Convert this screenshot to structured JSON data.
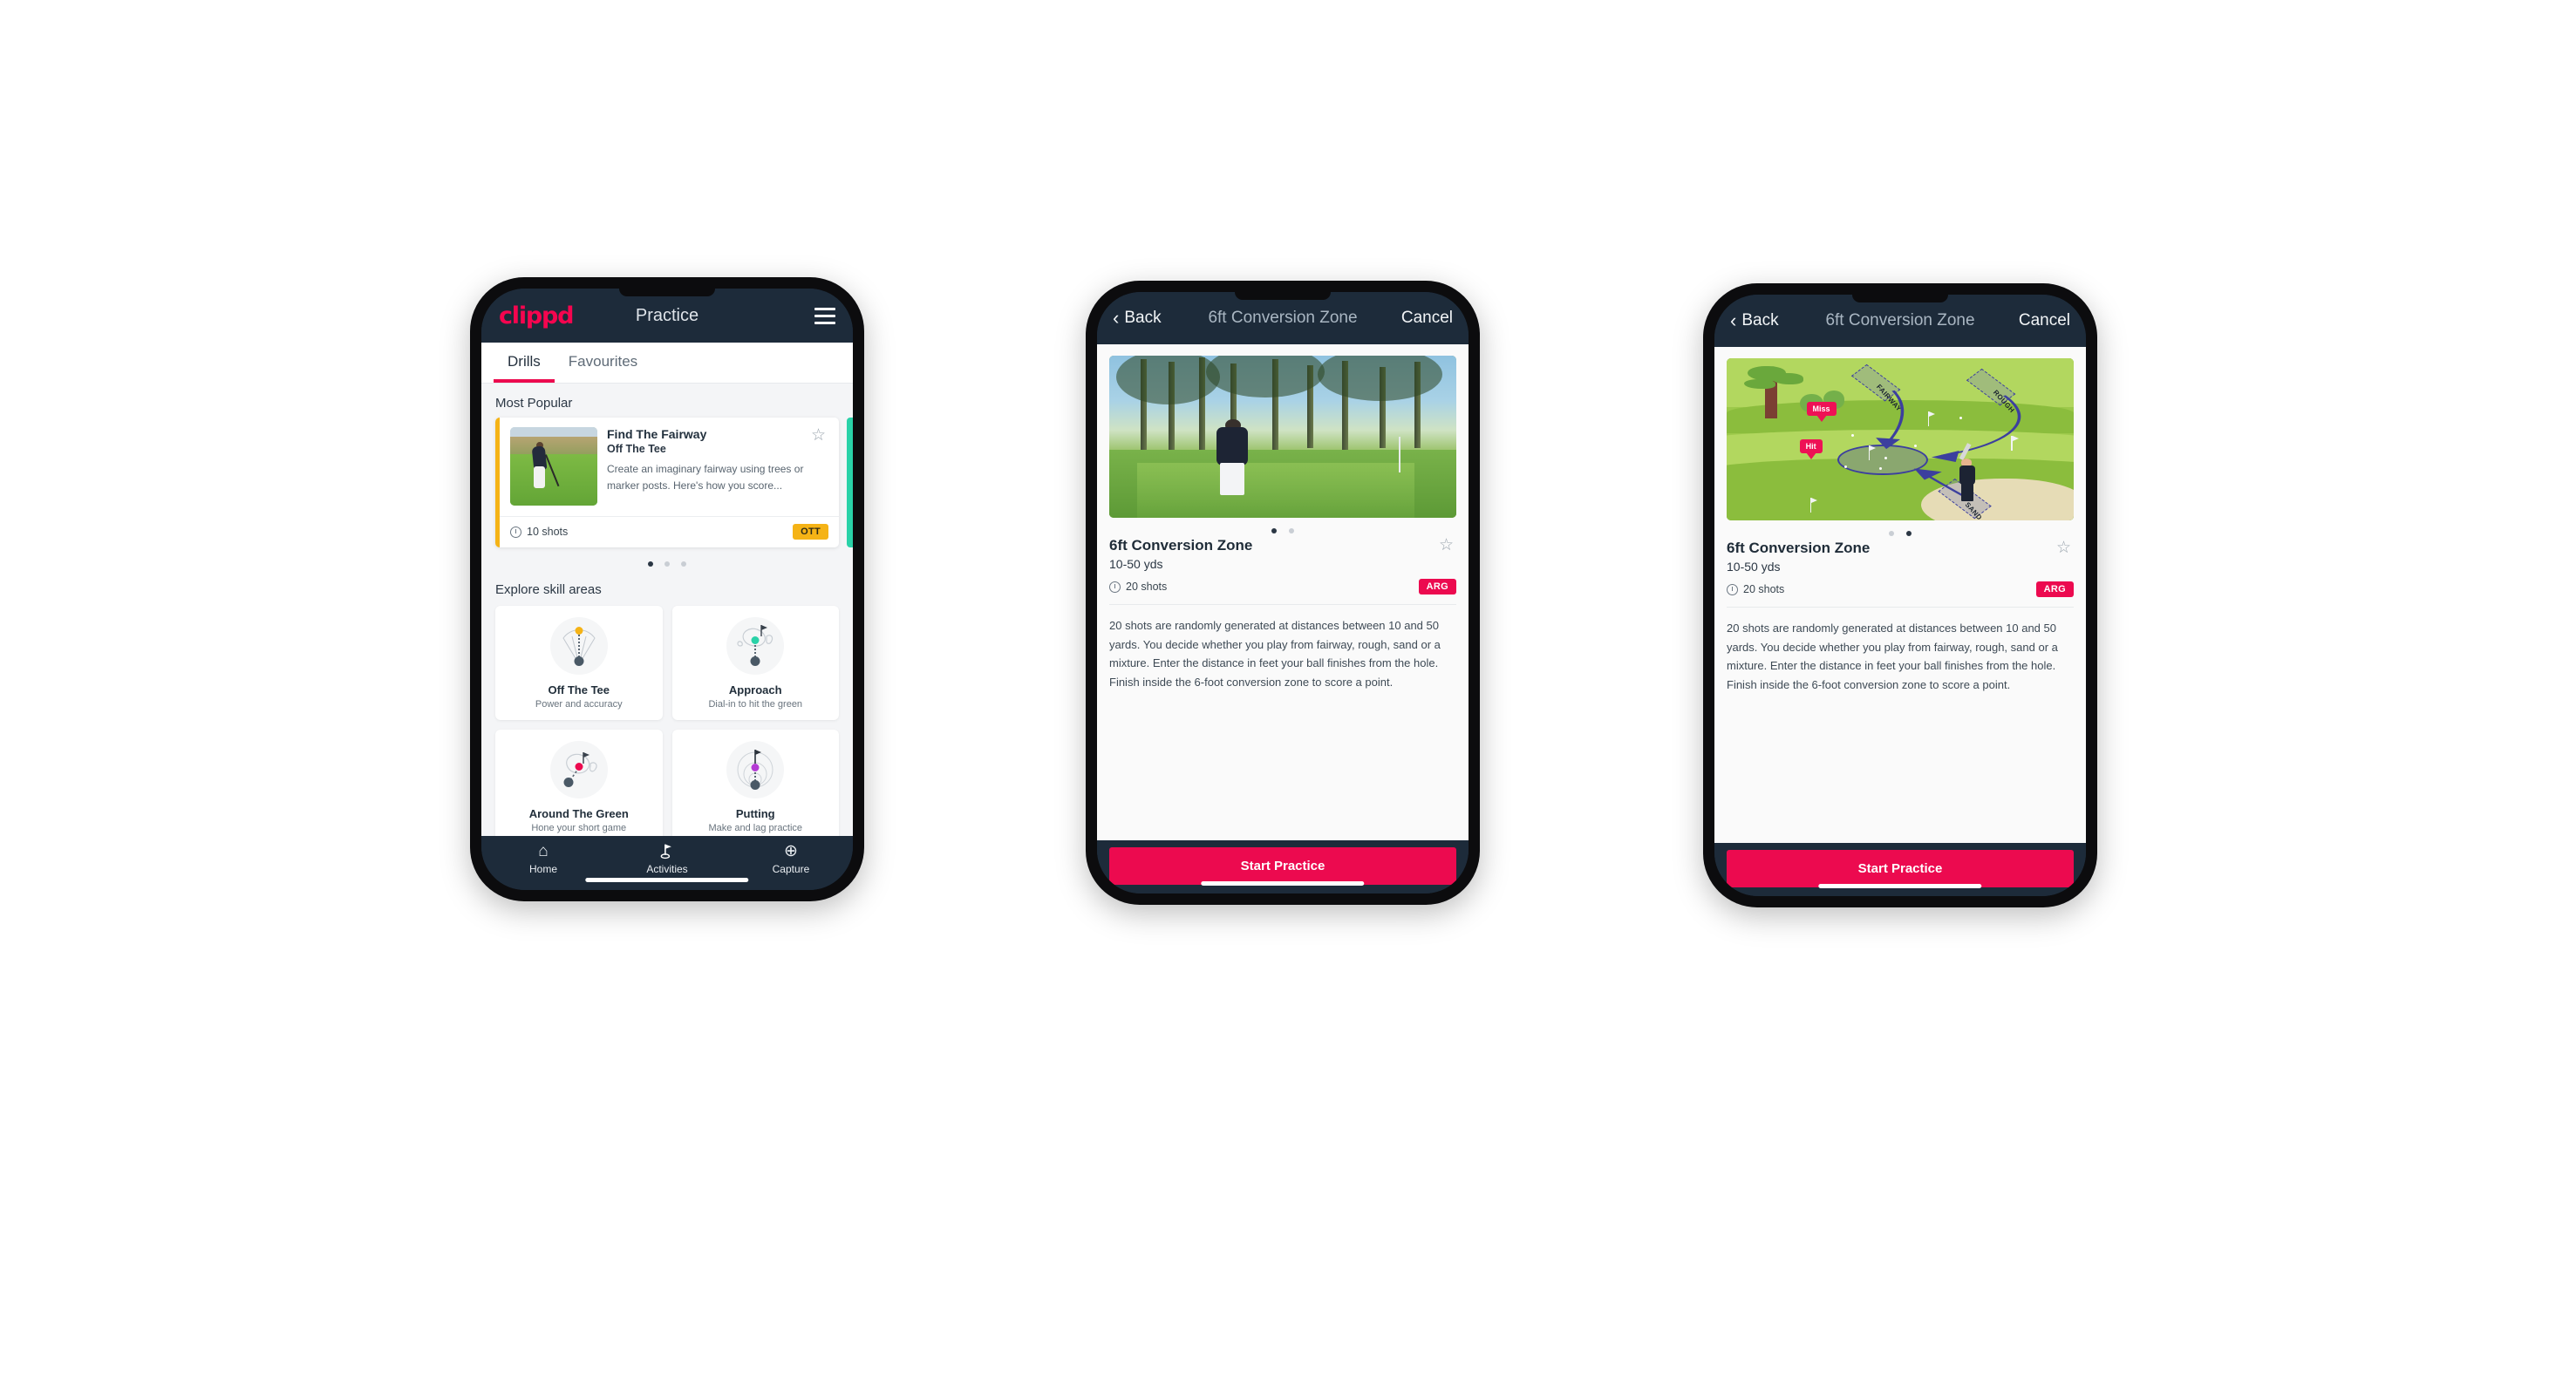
{
  "app": {
    "brand": "clippd",
    "accent_pink": "#ec0a4f",
    "header_navy": "#1d2b3a",
    "amber": "#f5b316",
    "teal": "#2ad2a8"
  },
  "phone1": {
    "header": {
      "title": "Practice",
      "menu_icon": "hamburger-icon"
    },
    "tabs": [
      {
        "label": "Drills",
        "active": true
      },
      {
        "label": "Favourites",
        "active": false
      }
    ],
    "most_popular": {
      "section_title": "Most Popular",
      "card": {
        "name": "Find The Fairway",
        "category": "Off The Tee",
        "description": "Create an imaginary fairway using trees or marker posts. Here's how you score...",
        "shots": "10 shots",
        "badge": "OTT",
        "favourite_icon": "star-outline-icon"
      },
      "dots": [
        true,
        false,
        false
      ]
    },
    "explore": {
      "section_title": "Explore skill areas",
      "items": [
        {
          "name": "Off The Tee",
          "sub": "Power and accuracy",
          "dot_color": "#f5b316"
        },
        {
          "name": "Approach",
          "sub": "Dial-in to hit the green",
          "dot_color": "#2ad2a8"
        },
        {
          "name": "Around The Green",
          "sub": "Hone your short game",
          "dot_color": "#ec0a4f"
        },
        {
          "name": "Putting",
          "sub": "Make and lag practice",
          "dot_color": "#b43bd4"
        }
      ]
    },
    "bottom_nav": [
      {
        "label": "Home",
        "icon": "home-icon"
      },
      {
        "label": "Activities",
        "icon": "golf-flag-icon"
      },
      {
        "label": "Capture",
        "icon": "plus-circle-icon"
      }
    ]
  },
  "phone2": {
    "nav": {
      "back": "Back",
      "title": "6ft Conversion Zone",
      "cancel": "Cancel"
    },
    "media": "golfer-chipping-photo",
    "dots": [
      true,
      false
    ],
    "detail": {
      "title": "6ft Conversion Zone",
      "subtitle": "10-50 yds",
      "shots": "20 shots",
      "badge": "ARG",
      "favourite_icon": "star-outline-icon",
      "description": "20 shots are randomly generated at distances between 10 and 50 yards. You decide whether you play from fairway, rough, sand or a mixture. Enter the distance in feet your ball finishes from the hole. Finish inside the 6-foot conversion zone to score a point."
    },
    "cta": "Start Practice"
  },
  "phone3": {
    "nav": {
      "back": "Back",
      "title": "6ft Conversion Zone",
      "cancel": "Cancel"
    },
    "media": "golf-course-illustration",
    "illustration": {
      "labels": [
        "FAIRWAY",
        "ROUGH",
        "SAND"
      ],
      "tags": [
        "Miss",
        "Hit"
      ]
    },
    "dots": [
      false,
      true
    ],
    "detail": {
      "title": "6ft Conversion Zone",
      "subtitle": "10-50 yds",
      "shots": "20 shots",
      "badge": "ARG",
      "favourite_icon": "star-outline-icon",
      "description": "20 shots are randomly generated at distances between 10 and 50 yards. You decide whether you play from fairway, rough, sand or a mixture. Enter the distance in feet your ball finishes from the hole. Finish inside the 6-foot conversion zone to score a point."
    },
    "cta": "Start Practice"
  }
}
